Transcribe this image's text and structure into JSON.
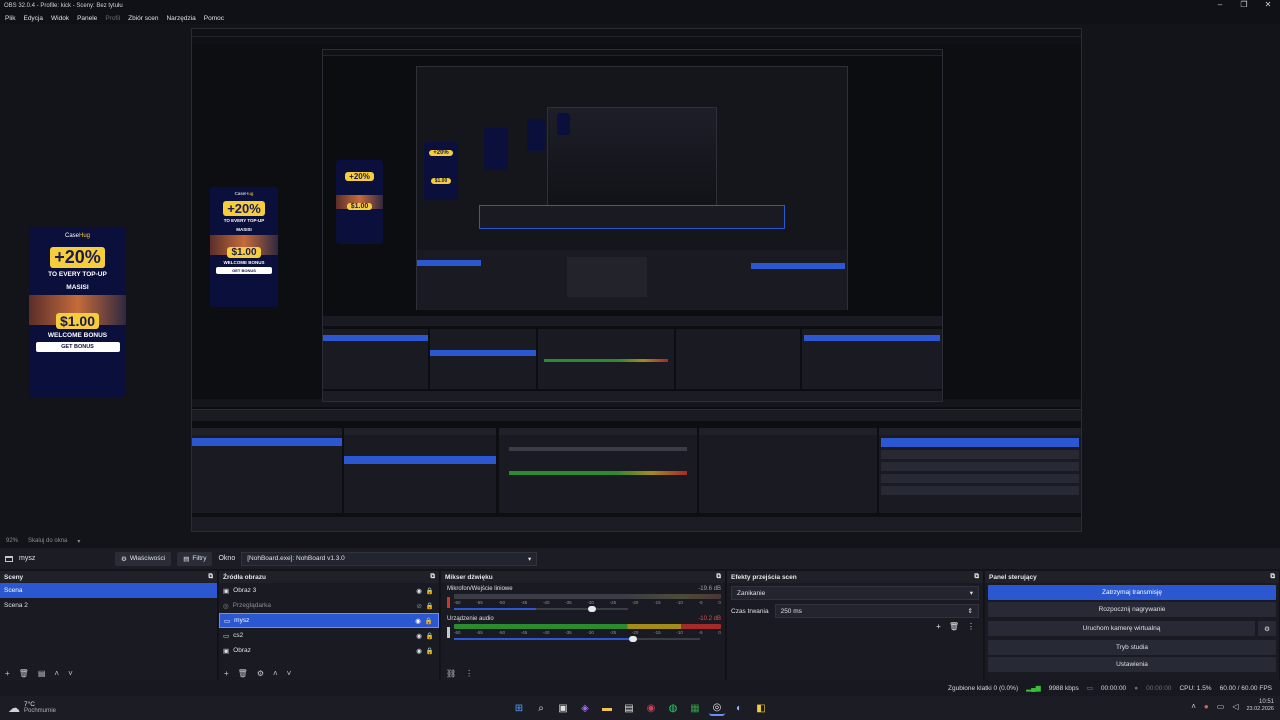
{
  "window": {
    "title": "OBS 32.0.4 - Profile: kick - Sceny: Bez tytułu",
    "controls": [
      "–",
      "❐",
      "✕"
    ]
  },
  "menu": {
    "items": [
      "Plik",
      "Edycja",
      "Widok",
      "Panele",
      "Profil",
      "Zbiór scen",
      "Narzędzia",
      "Pomoc"
    ]
  },
  "ad": {
    "brand": "Case",
    "brand2": "Hug",
    "percent": "+20%",
    "line1": "TO EVERY TOP-UP",
    "line2": "MASISI",
    "price": "$1.00",
    "line3": "WELCOME BONUS",
    "cta": "GET BONUS"
  },
  "zoom": {
    "level": "92%",
    "scale_label": "Skaluj do okna"
  },
  "source_toolbar": {
    "source_name": "mysz",
    "properties_label": "Właściwości",
    "filters_label": "Filtry",
    "window_label": "Okno",
    "window_value": "[NohBoard.exe]: NohBoard v1.3.0"
  },
  "scenes": {
    "title": "Sceny",
    "items": [
      "Scena",
      "Scena 2"
    ]
  },
  "sources": {
    "title": "Źródła obrazu",
    "items": [
      {
        "name": "Obraz 3",
        "icon": "image-icon"
      },
      {
        "name": "Przeglądarka",
        "icon": "globe-icon"
      },
      {
        "name": "mysz",
        "icon": "window-icon"
      },
      {
        "name": "cs2",
        "icon": "monitor-icon"
      },
      {
        "name": "Obraz",
        "icon": "image-icon"
      }
    ]
  },
  "mixer": {
    "title": "Mikser dźwięku",
    "channels": [
      {
        "name": "Mikrofon/Wejście liniowe",
        "db": "-19.6 dB",
        "level": 0.0
      },
      {
        "name": "Urządzenie audio",
        "db": "-10.2 dB",
        "level": 0.72
      }
    ],
    "ticks": [
      "-60",
      "-55",
      "-50",
      "-45",
      "-40",
      "-35",
      "-30",
      "-25",
      "-20",
      "-15",
      "-10",
      "-5",
      "0"
    ]
  },
  "transitions": {
    "title": "Efekty przejścia scen",
    "selected": "Zanikanie",
    "duration_label": "Czas trwania",
    "duration_value": "250 ms"
  },
  "controls": {
    "title": "Panel sterujący",
    "buttons": [
      "Zatrzymaj transmisję",
      "Rozpocznij nagrywanie",
      "Uruchom kamerę wirtualną",
      "Tryb studia",
      "Ustawienia"
    ]
  },
  "status": {
    "dropped": "Zgubione klatki 0 (0.0%)",
    "bitrate": "9988 kbps",
    "stream_time": "00:00:00",
    "rec_time": "00:00:00",
    "cpu": "CPU: 1.5%",
    "fps": "60.00 / 60.00 FPS"
  },
  "taskbar": {
    "weather_temp": "7°C",
    "weather_desc": "Pochmurnie",
    "time": "10:51",
    "date": "23.02.2026"
  },
  "colors": {
    "accent": "#2b57d1",
    "background": "#131419",
    "panel": "#1a1b22"
  }
}
